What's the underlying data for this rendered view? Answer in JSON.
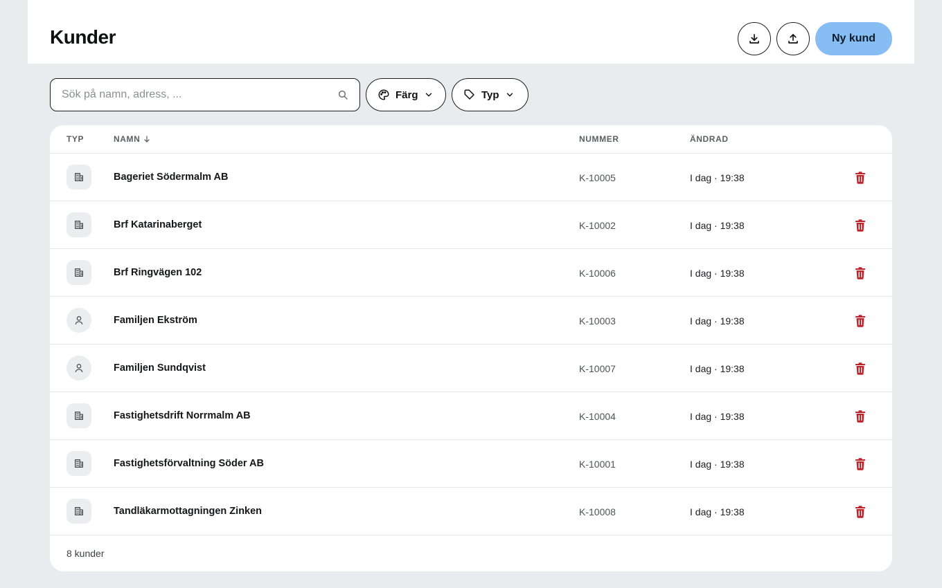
{
  "header": {
    "title": "Kunder",
    "download_icon": "download-icon",
    "upload_icon": "upload-icon",
    "new_customer_label": "Ny kund"
  },
  "toolbar": {
    "search_placeholder": "Sök på namn, adress, ...",
    "search_value": "",
    "filter_color_label": "Färg",
    "filter_type_label": "Typ"
  },
  "table": {
    "columns": {
      "type": "TYP",
      "name": "NAMN",
      "number": "NUMMER",
      "changed": "ÄNDRAD"
    },
    "sort": {
      "column": "name",
      "direction": "ascending"
    },
    "rows": [
      {
        "type": "org",
        "name": "Bageriet Södermalm AB",
        "number": "K-10005",
        "changed": "I dag · 19:38"
      },
      {
        "type": "org",
        "name": "Brf Katarinaberget",
        "number": "K-10002",
        "changed": "I dag · 19:38"
      },
      {
        "type": "org",
        "name": "Brf Ringvägen 102",
        "number": "K-10006",
        "changed": "I dag · 19:38"
      },
      {
        "type": "person",
        "name": "Familjen Ekström",
        "number": "K-10003",
        "changed": "I dag · 19:38"
      },
      {
        "type": "person",
        "name": "Familjen Sundqvist",
        "number": "K-10007",
        "changed": "I dag · 19:38"
      },
      {
        "type": "org",
        "name": "Fastighetsdrift Norrmalm AB",
        "number": "K-10004",
        "changed": "I dag · 19:38"
      },
      {
        "type": "org",
        "name": "Fastighetsförvaltning Söder AB",
        "number": "K-10001",
        "changed": "I dag · 19:38"
      },
      {
        "type": "org",
        "name": "Tandläkarmottagningen Zinken",
        "number": "K-10008",
        "changed": "I dag · 19:38"
      }
    ],
    "footer_count": "8 kunder"
  },
  "colors": {
    "background": "#e8ecef",
    "primary_button": "#86bdf3",
    "delete_icon": "#c0242b",
    "badge_bg": "#ebedef"
  }
}
